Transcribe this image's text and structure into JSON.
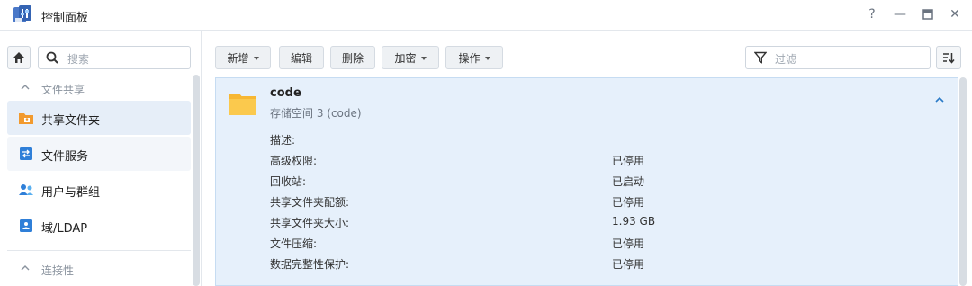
{
  "window": {
    "title": "控制面板",
    "controls": [
      "?",
      "—",
      "▭",
      "✕"
    ]
  },
  "sidebar": {
    "search_placeholder": "搜索",
    "group_file_sharing": "文件共享",
    "items": [
      {
        "label": "共享文件夹",
        "icon": "shared-folder-icon"
      },
      {
        "label": "文件服务",
        "icon": "file-services-icon"
      },
      {
        "label": "用户与群组",
        "icon": "user-group-icon"
      },
      {
        "label": "域/LDAP",
        "icon": "domain-ldap-icon"
      }
    ],
    "group_connectivity": "连接性"
  },
  "toolbar": {
    "create": "新增",
    "edit": "编辑",
    "delete": "删除",
    "encrypt": "加密",
    "action": "操作",
    "filter_placeholder": "过滤"
  },
  "shared_folder": {
    "name": "code",
    "location": "存储空间 3 (code)",
    "properties": [
      {
        "label": "描述:",
        "value": ""
      },
      {
        "label": "高级权限:",
        "value": "已停用"
      },
      {
        "label": "回收站:",
        "value": "已启动"
      },
      {
        "label": "共享文件夹配额:",
        "value": "已停用"
      },
      {
        "label": "共享文件夹大小:",
        "value": "1.93 GB"
      },
      {
        "label": "文件压缩:",
        "value": "已停用"
      },
      {
        "label": "数据完整性保护:",
        "value": "已停用"
      }
    ]
  },
  "colors": {
    "accent": "#2a7ac7",
    "selected_bg": "#e6f0fb",
    "folder": "#f7b733"
  }
}
